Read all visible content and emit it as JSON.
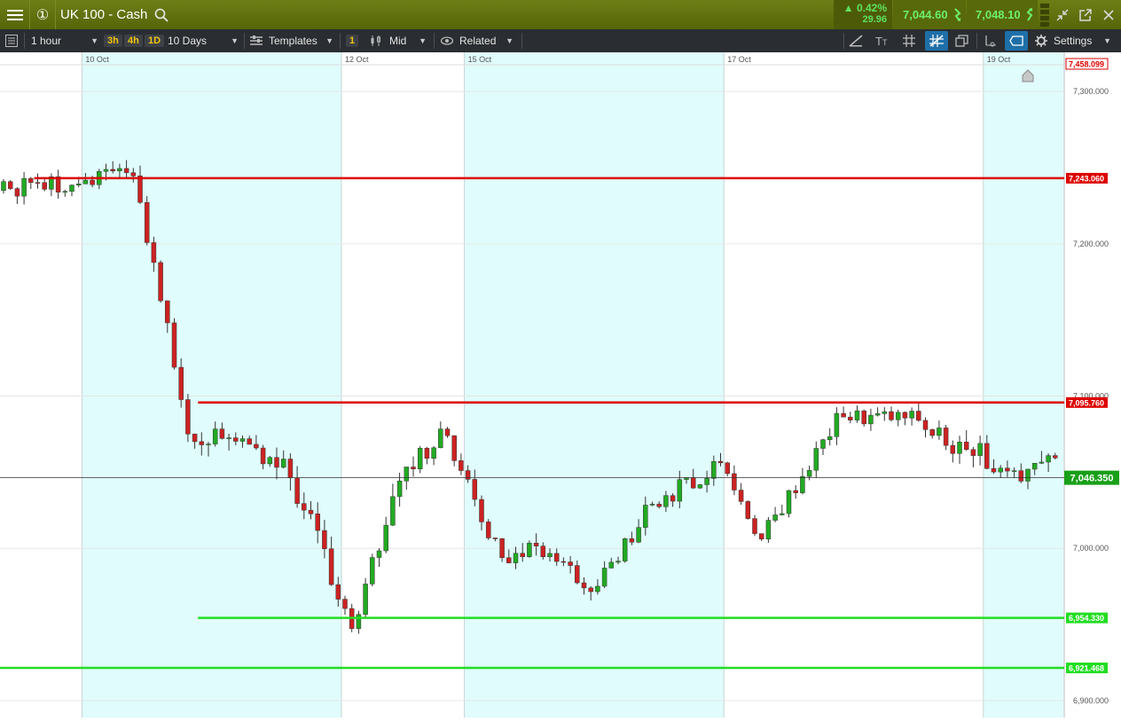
{
  "app": {
    "instrument": "UK 100 - Cash",
    "change_pct": "▲ 0.42%",
    "change_pts": "29.96",
    "sell_price": "7,044.60",
    "buy_price": "7,048.10",
    "info_glyph": "①"
  },
  "toolbar": {
    "interval": "1 hour",
    "quick_intervals": [
      "3h",
      "4h",
      "1D"
    ],
    "range": "10 Days",
    "templates": "Templates",
    "chart_count": "1",
    "price_type": "Mid",
    "related": "Related",
    "settings": "Settings"
  },
  "icons": [
    "menu-icon",
    "info-icon",
    "search-icon",
    "trend-down-arrow-icon",
    "trend-up-arrow-icon",
    "depth-bars-icon",
    "popout-icon",
    "close-icon",
    "list-icon",
    "templates-icon",
    "candlestick-icon",
    "eye-icon",
    "line-draw-icon",
    "text-tool-icon",
    "grid-icon",
    "fib-icon",
    "layers-icon",
    "indicator-icon",
    "shape-icon",
    "gear-icon",
    "scroll-up-icon"
  ],
  "colors": {
    "header_green": "#5f6f0f",
    "toolbar_bg": "#2a2d31",
    "bull": "#22aa22",
    "bear": "#cc2222",
    "resistance": "#dd0000",
    "support": "#22dd22",
    "band": "#e0fcfc"
  },
  "chart_data": {
    "type": "candlestick",
    "date_labels": [
      {
        "label": "10 Oct",
        "bar": 12
      },
      {
        "label": "12 Oct",
        "bar": 50
      },
      {
        "label": "15 Oct",
        "bar": 68
      },
      {
        "label": "17 Oct",
        "bar": 106
      },
      {
        "label": "19 Oct",
        "bar": 144
      }
    ],
    "ylim": [
      6900,
      7310
    ],
    "y_ticks": [
      "7,300.000",
      "7,200.000",
      "7,100.000",
      "7,000.000",
      "6,900.000"
    ],
    "y_tick_values": [
      7300,
      7200,
      7100,
      7000,
      6900
    ],
    "top_marker": "7,458.099",
    "current_price": {
      "label": "7,046.350",
      "value": 7046.35
    },
    "horizontal_lines": [
      {
        "label": "7,243.060",
        "value": 7243.06,
        "kind": "resistance",
        "start_bar": 5
      },
      {
        "label": "7,095.760",
        "value": 7095.76,
        "kind": "resistance",
        "start_bar": 29
      },
      {
        "label": "6,954.330",
        "value": 6954.33,
        "kind": "support",
        "start_bar": 29
      },
      {
        "label": "6,921.468",
        "value": 6921.468,
        "kind": "support",
        "start_bar": 0
      }
    ],
    "shaded_bands": [
      [
        12,
        50
      ],
      [
        68,
        106
      ],
      [
        144,
        157
      ]
    ],
    "segments": [
      {
        "from": 0,
        "to": 7240,
        "steps": [
          [
            20,
            7245
          ]
        ],
        "seed": 1,
        "noise": 6
      },
      {
        "from": 7245,
        "to": 7240,
        "steps": [
          [
            8,
            7082
          ],
          [
            14,
            7060
          ]
        ],
        "seed": 2,
        "noise": 8
      },
      {
        "from": 7060,
        "to": 7060,
        "steps": [
          [
            10,
            6950
          ],
          [
            8,
            7058
          ]
        ],
        "seed": 3,
        "noise": 9
      },
      {
        "from": 7058,
        "to": 7058,
        "steps": [
          [
            6,
            7075
          ],
          [
            8,
            6990
          ],
          [
            6,
            7000
          ]
        ],
        "seed": 4,
        "noise": 7
      },
      {
        "from": 7000,
        "to": 7000,
        "steps": [
          [
            8,
            6975
          ],
          [
            8,
            7030
          ],
          [
            10,
            7055
          ]
        ],
        "seed": 5,
        "noise": 6
      },
      {
        "from": 7055,
        "to": 7055,
        "steps": [
          [
            6,
            7005
          ],
          [
            12,
            7090
          ],
          [
            10,
            7085
          ]
        ],
        "seed": 6,
        "noise": 6
      },
      {
        "from": 7085,
        "to": 7085,
        "steps": [
          [
            8,
            7060
          ],
          [
            8,
            7050
          ],
          [
            8,
            7070
          ],
          [
            6,
            7040
          ]
        ],
        "seed": 7,
        "noise": 8
      },
      {
        "from": 7040,
        "to": 7040,
        "steps": [
          [
            8,
            7000
          ],
          [
            6,
            7010
          ],
          [
            10,
            7050
          ]
        ],
        "seed": 8,
        "noise": 6
      }
    ]
  }
}
